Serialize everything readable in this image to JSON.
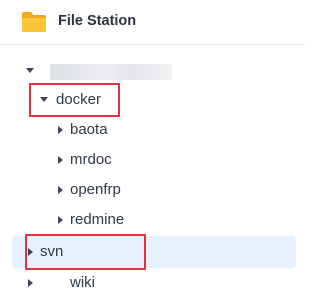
{
  "header": {
    "title": "File Station",
    "icon": "folder-icon"
  },
  "tree": {
    "root": {
      "label": "",
      "expanded": true
    },
    "docker": {
      "label": "docker",
      "expanded": true,
      "children": [
        {
          "label": "baota"
        },
        {
          "label": "mrdoc"
        },
        {
          "label": "openfrp"
        },
        {
          "label": "redmine"
        },
        {
          "label": "svn",
          "selected": true
        },
        {
          "label": "wiki"
        }
      ]
    }
  },
  "colors": {
    "selection": "#e7f1fd",
    "annotation": "#e2323c",
    "folder": "#f5b51e"
  }
}
